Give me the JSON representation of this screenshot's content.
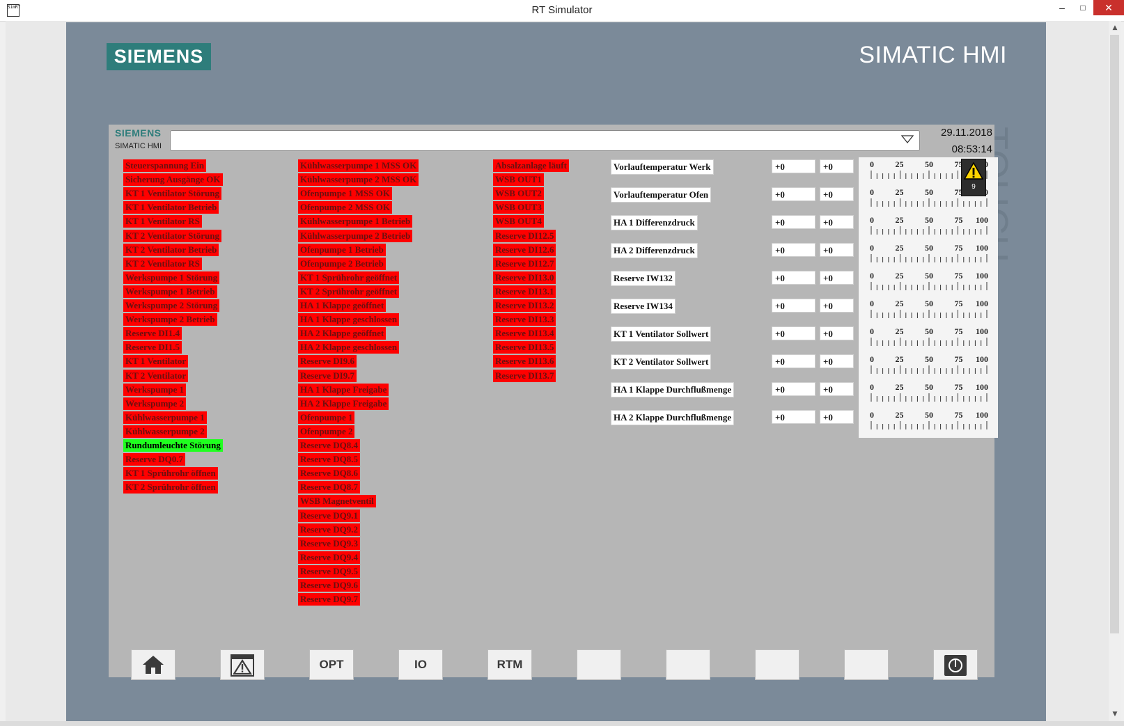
{
  "window": {
    "title": "RT Simulator",
    "app_icon_text": "SimRT",
    "minimize": "–",
    "maximize": "□",
    "close": "✕"
  },
  "device": {
    "brand": "SIEMENS",
    "model": "SIMATIC HMI",
    "side_label": "TOUCH"
  },
  "header": {
    "brand": "SIEMENS",
    "model": "SIMATIC HMI",
    "date": "29.11.2018",
    "time": "08:53:14",
    "alarm_count": "9"
  },
  "colors": {
    "signal_off": "#ff0000",
    "signal_on": "#1fff1f",
    "device_frame": "#7b8a99",
    "screen": "#b6b6b6",
    "brand_teal": "#2e7d7b"
  },
  "col1": [
    {
      "label": "Steuerspannung Ein",
      "state": "off"
    },
    {
      "label": "Sicherung Ausgänge OK",
      "state": "off"
    },
    {
      "label": "KT 1 Ventilator Störung",
      "state": "off"
    },
    {
      "label": "KT 1 Ventilator Betrieb",
      "state": "off"
    },
    {
      "label": "KT 1 Ventilator RS",
      "state": "off"
    },
    {
      "label": "KT 2 Ventilator Störung",
      "state": "off"
    },
    {
      "label": "KT 2 Ventilator Betrieb",
      "state": "off"
    },
    {
      "label": "KT 2 Ventilator RS",
      "state": "off"
    },
    {
      "label": "Werkspumpe 1 Störung",
      "state": "off"
    },
    {
      "label": "Werkspumpe 1 Betrieb",
      "state": "off"
    },
    {
      "label": "Werkspumpe 2 Störung",
      "state": "off"
    },
    {
      "label": "Werkspumpe 2 Betrieb",
      "state": "off"
    },
    {
      "label": "Reserve DI1.4",
      "state": "off"
    },
    {
      "label": "Reserve DI1.5",
      "state": "off"
    },
    {
      "label": "KT 1 Ventilator",
      "state": "off"
    },
    {
      "label": "KT 2 Ventilator",
      "state": "off"
    },
    {
      "label": "Werkspumpe 1",
      "state": "off"
    },
    {
      "label": "Werkspumpe 2",
      "state": "off"
    },
    {
      "label": "Kühlwasserpumpe 1",
      "state": "off"
    },
    {
      "label": "Kühlwasserpumpe 2",
      "state": "off"
    },
    {
      "label": "Rundumleuchte Störung",
      "state": "on"
    },
    {
      "label": "Reserve DQ0.7",
      "state": "off"
    },
    {
      "label": "KT 1 Sprührohr öffnen",
      "state": "off"
    },
    {
      "label": "KT 2 Sprührohr öffnen",
      "state": "off"
    }
  ],
  "col2": [
    {
      "label": "Kühlwasserpumpe 1 MSS OK",
      "state": "off"
    },
    {
      "label": "Kühlwasserpumpe 2 MSS OK",
      "state": "off"
    },
    {
      "label": "Ofenpumpe 1 MSS OK",
      "state": "off"
    },
    {
      "label": "Ofenpumpe 2 MSS OK",
      "state": "off"
    },
    {
      "label": "Kühlwasserpumpe 1 Betrieb",
      "state": "off"
    },
    {
      "label": "Kühlwasserpumpe 2 Betrieb",
      "state": "off"
    },
    {
      "label": "Ofenpumpe 1 Betrieb",
      "state": "off"
    },
    {
      "label": "Ofenpumpe 2 Betrieb",
      "state": "off"
    },
    {
      "label": "KT 1 Sprührohr geöffnet",
      "state": "off"
    },
    {
      "label": "KT 2 Sprührohr geöffnet",
      "state": "off"
    },
    {
      "label": "HA 1 Klappe geöffnet",
      "state": "off"
    },
    {
      "label": "HA 1 Klappe geschlossen",
      "state": "off"
    },
    {
      "label": "HA 2 Klappe geöffnet",
      "state": "off"
    },
    {
      "label": "HA 2 Klappe geschlossen",
      "state": "off"
    },
    {
      "label": "Reserve DI9.6",
      "state": "off"
    },
    {
      "label": "Reserve DI9.7",
      "state": "off"
    },
    {
      "label": "HA 1 Klappe Freigabe",
      "state": "off"
    },
    {
      "label": "HA 2 Klappe Freigabe",
      "state": "off"
    },
    {
      "label": "Ofenpumpe 1",
      "state": "off"
    },
    {
      "label": "Ofenpumpe 2",
      "state": "off"
    },
    {
      "label": "Reserve DQ8.4",
      "state": "off"
    },
    {
      "label": "Reserve DQ8.5",
      "state": "off"
    },
    {
      "label": "Reserve DQ8.6",
      "state": "off"
    },
    {
      "label": "Reserve DQ8.7",
      "state": "off"
    },
    {
      "label": "WSB Magnetventil",
      "state": "off"
    },
    {
      "label": "Reserve DQ9.1",
      "state": "off"
    },
    {
      "label": "Reserve DQ9.2",
      "state": "off"
    },
    {
      "label": "Reserve DQ9.3",
      "state": "off"
    },
    {
      "label": "Reserve DQ9.4",
      "state": "off"
    },
    {
      "label": "Reserve DQ9.5",
      "state": "off"
    },
    {
      "label": "Reserve DQ9.6",
      "state": "off"
    },
    {
      "label": "Reserve DQ9.7",
      "state": "off"
    }
  ],
  "col3": [
    {
      "label": "Absalzanlage läuft",
      "state": "off"
    },
    {
      "label": "WSB OUT1",
      "state": "off"
    },
    {
      "label": "WSB OUT2",
      "state": "off"
    },
    {
      "label": "WSB OUT3",
      "state": "off"
    },
    {
      "label": "WSB OUT4",
      "state": "off"
    },
    {
      "label": "Reserve DI12.5",
      "state": "off"
    },
    {
      "label": "Reserve DI12.6",
      "state": "off"
    },
    {
      "label": "Reserve DI12.7",
      "state": "off"
    },
    {
      "label": "Reserve DI13.0",
      "state": "off"
    },
    {
      "label": "Reserve DI13.1",
      "state": "off"
    },
    {
      "label": "Reserve DI13.2",
      "state": "off"
    },
    {
      "label": "Reserve DI13.3",
      "state": "off"
    },
    {
      "label": "Reserve DI13.4",
      "state": "off"
    },
    {
      "label": "Reserve DI13.5",
      "state": "off"
    },
    {
      "label": "Reserve DI13.6",
      "state": "off"
    },
    {
      "label": "Reserve DI13.7",
      "state": "off"
    }
  ],
  "analog": [
    {
      "label": "Vorlauftemperatur Werk",
      "raw": "+0",
      "value": "+0"
    },
    {
      "label": "Vorlauftemperatur Ofen",
      "raw": "+0",
      "value": "+0"
    },
    {
      "label": "HA 1 Differenzdruck",
      "raw": "+0",
      "value": "+0"
    },
    {
      "label": "HA 2 Differenzdruck",
      "raw": "+0",
      "value": "+0"
    },
    {
      "label": "Reserve IW132",
      "raw": "+0",
      "value": "+0"
    },
    {
      "label": "Reserve IW134",
      "raw": "+0",
      "value": "+0"
    },
    {
      "label": "KT 1 Ventilator Sollwert",
      "raw": "+0",
      "value": "+0"
    },
    {
      "label": "KT 2 Ventilator Sollwert",
      "raw": "+0",
      "value": "+0"
    },
    {
      "label": "HA 1 Klappe Durchflußmenge",
      "raw": "+0",
      "value": "+0"
    },
    {
      "label": "HA 2 Klappe Durchflußmenge",
      "raw": "+0",
      "value": "+0"
    }
  ],
  "scale_ticks": [
    "0",
    "25",
    "50",
    "75",
    "100"
  ],
  "function_keys": [
    {
      "name": "home-button",
      "label": "",
      "icon": "home-icon"
    },
    {
      "name": "alarm-view-button",
      "label": "",
      "icon": "warning-icon"
    },
    {
      "name": "opt-button",
      "label": "OPT",
      "icon": ""
    },
    {
      "name": "io-button",
      "label": "IO",
      "icon": ""
    },
    {
      "name": "rtm-button",
      "label": "RTM",
      "icon": ""
    },
    {
      "name": "fkey-6-button",
      "label": "",
      "icon": ""
    },
    {
      "name": "fkey-7-button",
      "label": "",
      "icon": ""
    },
    {
      "name": "fkey-8-button",
      "label": "",
      "icon": ""
    },
    {
      "name": "fkey-9-button",
      "label": "",
      "icon": ""
    },
    {
      "name": "power-button",
      "label": "",
      "icon": "power-icon"
    }
  ]
}
